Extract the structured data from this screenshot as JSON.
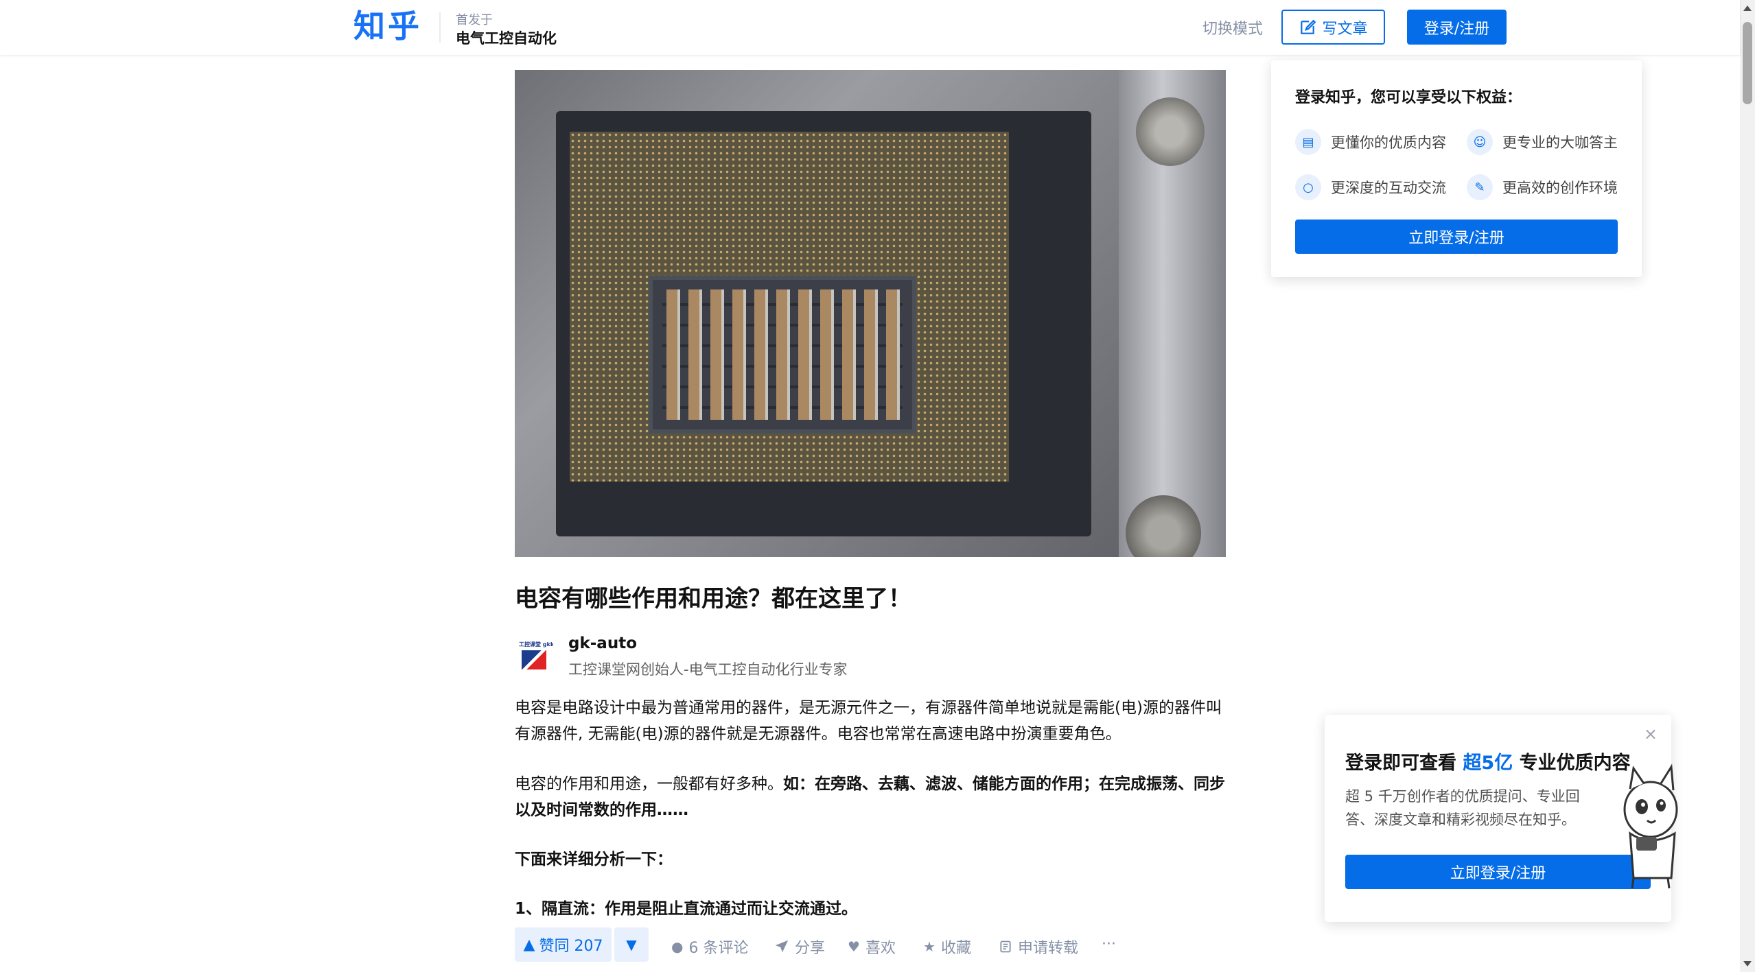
{
  "header": {
    "logo": "知乎",
    "published_in_label": "首发于",
    "publication_name": "电气工控自动化",
    "switch_mode": "切换模式",
    "write_article": "写文章",
    "login_register": "登录/注册"
  },
  "article": {
    "title": "电容有哪些作用和用途？都在这里了！",
    "author": {
      "avatar_text": "工控课堂 gkket",
      "name": "gk-auto",
      "bio": "工控课堂网创始人-电气工控自动化行业专家"
    },
    "p1": "电容是电路设计中最为普通常用的器件，是无源元件之一，有源器件简单地说就是需能(电)源的器件叫有源器件, 无需能(电)源的器件就是无源器件。电容也常常在高速电路中扮演重要角色。",
    "p2_normal": "电容的作用和用途，一般都有好多种。",
    "p2_bold": "如：在旁路、去藕、滤波、储能方面的作用；在完成振荡、同步以及时间常数的作用……",
    "p3": "下面来详细分析一下：",
    "p4": "1、隔直流：作用是阻止直流通过而让交流通过。"
  },
  "actions": {
    "upvote": "赞同 207",
    "comments": "6 条评论",
    "share": "分享",
    "like": "喜欢",
    "collect": "收藏",
    "repost": "申请转载",
    "more": "···"
  },
  "login_popover": {
    "title": "登录知乎，您可以享受以下权益：",
    "benefits": [
      {
        "label": "更懂你的优质内容",
        "icon": "document-icon"
      },
      {
        "label": "更专业的大咖答主",
        "icon": "expert-icon"
      },
      {
        "label": "更深度的互动交流",
        "icon": "chat-icon"
      },
      {
        "label": "更高效的创作环境",
        "icon": "edit-icon"
      }
    ],
    "button": "立即登录/注册"
  },
  "promo_card": {
    "title_prefix": "登录即可查看",
    "title_highlight": "超5亿",
    "title_suffix": "专业优质内容",
    "description": "超 5 千万创作者的优质提问、专业回答、深度文章和精彩视频尽在知乎。",
    "button": "立即登录/注册",
    "close": "×"
  },
  "colors": {
    "brand_blue": "#056de8",
    "logo_blue": "#1772f6",
    "muted_text": "#8590a6"
  }
}
